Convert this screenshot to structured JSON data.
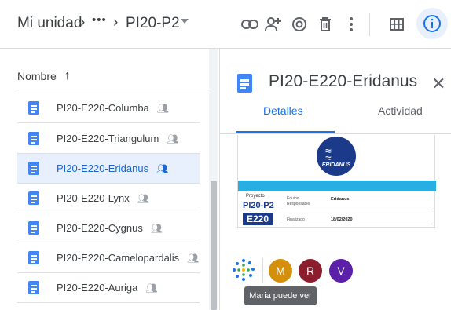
{
  "breadcrumb": {
    "root": "Mi unidad",
    "more": "•••",
    "current": "PI20-P2"
  },
  "toolbar": {
    "icons": [
      "link-icon",
      "add-person-icon",
      "preview-eye-icon",
      "trash-icon",
      "more-vert-icon",
      "grid-view-icon",
      "info-icon"
    ]
  },
  "list": {
    "column_header": "Nombre",
    "sort_arrow": "↑",
    "files": [
      {
        "name": "PI20-E220-Columba",
        "selected": false
      },
      {
        "name": "PI20-E220-Triangulum",
        "selected": false
      },
      {
        "name": "PI20-E220-Eridanus",
        "selected": true
      },
      {
        "name": "PI20-E220-Lynx",
        "selected": false
      },
      {
        "name": "PI20-E220-Cygnus",
        "selected": false
      },
      {
        "name": "PI20-E220-Camelopardalis",
        "selected": false
      },
      {
        "name": "PI20-E220-Auriga",
        "selected": false
      }
    ]
  },
  "details": {
    "title": "PI20-E220-Eridanus",
    "tab_details": "Detalles",
    "tab_activity": "Actividad",
    "preview": {
      "logo_text": "ERIDANUS",
      "proyecto_label": "Proyecto",
      "proyecto_code": "PI20-P2",
      "team_code": "E220",
      "equipo_label": "Equipo",
      "responsable_label": "Responsable",
      "equipo_value": "Eridanus",
      "finalizado_label": "Finalizado",
      "finalizado_value": "18/02/2020"
    },
    "avatars": [
      {
        "letter": "M",
        "color": "#d4900a"
      },
      {
        "letter": "R",
        "color": "#8b1d2c"
      },
      {
        "letter": "V",
        "color": "#5b1fa8"
      }
    ],
    "tooltip": "Maria puede ver"
  },
  "colors": {
    "accent": "#1a73e8",
    "selected_row": "#e8f0fe",
    "doc_icon": "#4285f4"
  }
}
